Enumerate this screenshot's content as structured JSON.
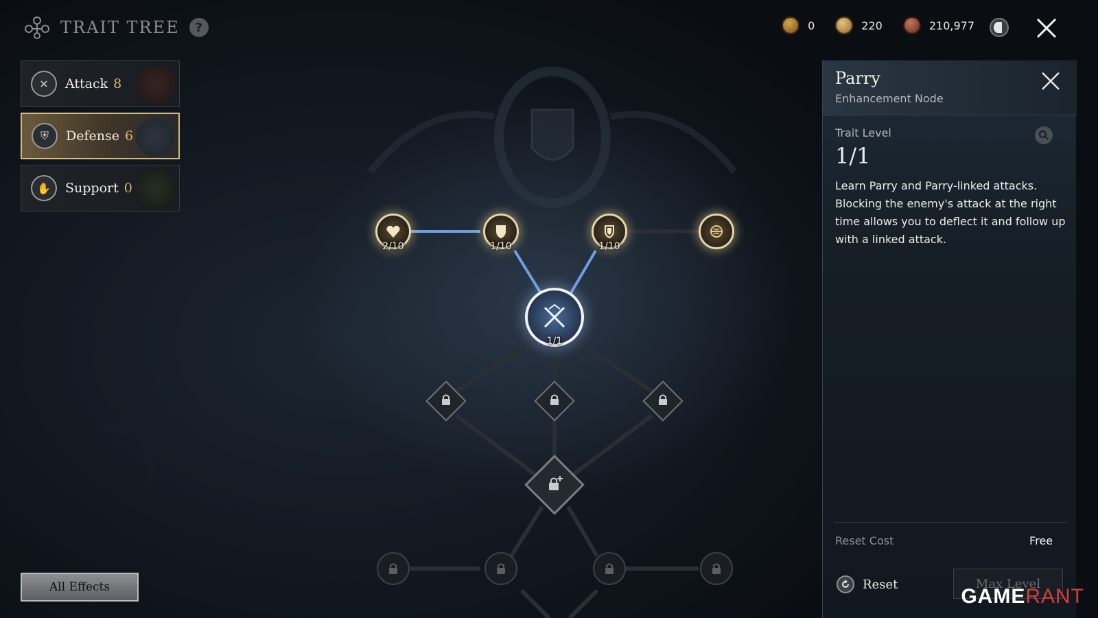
{
  "header": {
    "title": "TRAIT TREE",
    "help_label": "?"
  },
  "currencies": [
    {
      "value": "0",
      "icon": "gold-crest-coin-icon",
      "color": "#d8a44a"
    },
    {
      "value": "220",
      "icon": "gold-coin-icon",
      "color": "#e6c27a"
    },
    {
      "value": "210,977",
      "icon": "copper-coin-icon",
      "color": "#c2745a"
    }
  ],
  "categories": [
    {
      "label": "Attack",
      "count": "8",
      "active": false,
      "icon": "crossed-swords-icon"
    },
    {
      "label": "Defense",
      "count": "6",
      "active": true,
      "icon": "shield-icon"
    },
    {
      "label": "Support",
      "count": "0",
      "active": false,
      "icon": "gauntlet-icon"
    }
  ],
  "all_effects_label": "All Effects",
  "tree": {
    "top_nodes": [
      {
        "label": "2/10",
        "icon": "heart-icon"
      },
      {
        "label": "1/10",
        "icon": "shield-icon"
      },
      {
        "label": "1/10",
        "icon": "shield-crest-icon"
      },
      {
        "label": "",
        "icon": "sigil-icon"
      }
    ],
    "main_node": {
      "label": "1/1",
      "icon": "crossed-swords-icon",
      "name": "Parry"
    },
    "locked_mid": [
      "lock-icon",
      "lock-icon",
      "lock-icon"
    ],
    "locked_hub": "lock-plus-icon",
    "locked_bottom": [
      "lock-icon",
      "lock-icon",
      "lock-icon",
      "lock-icon"
    ]
  },
  "panel": {
    "title": "Parry",
    "subtitle": "Enhancement Node",
    "level_label": "Trait Level",
    "level": "1/1",
    "description": "Learn Parry and Parry-linked attacks. Blocking the enemy's attack at the right time allows you to deflect it and follow up with a linked attack.",
    "reset_cost_label": "Reset Cost",
    "reset_cost": "Free",
    "reset_label": "Reset",
    "max_level_label": "Max Level"
  },
  "watermark": {
    "game": "GAME",
    "rant": "RANT"
  },
  "colors": {
    "accent_gold": "#d9b66f",
    "active_link": "#6f9fe0",
    "inactive_link": "#2a2f36"
  }
}
